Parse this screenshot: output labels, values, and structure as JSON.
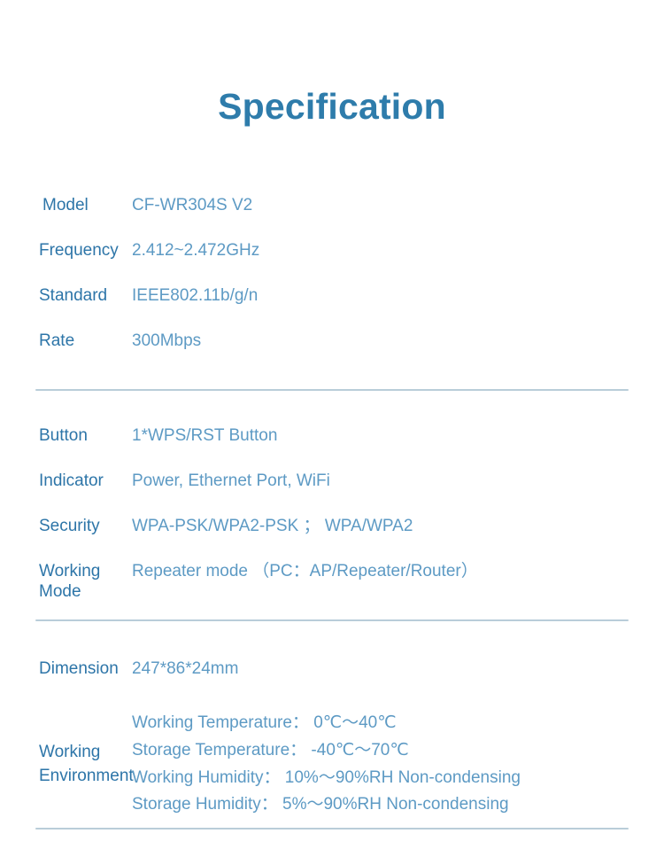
{
  "document": {
    "title": "Specification",
    "accent_color": "#2e7cab",
    "label_color": "#2d75a8",
    "value_color": "#5d9ac4",
    "divider_color": "#b9cdd9",
    "background_color": "#ffffff"
  },
  "sections": {
    "basic": {
      "rows": [
        {
          "label": "Model",
          "value": "CF-WR304S V2"
        },
        {
          "label": "Frequency",
          "value": "2.412~2.472GHz"
        },
        {
          "label": "Standard",
          "value": "IEEE802.11b/g/n"
        },
        {
          "label": "Rate",
          "value": "300Mbps"
        }
      ]
    },
    "features": {
      "rows": [
        {
          "label": "Button",
          "value": "1*WPS/RST Button"
        },
        {
          "label": "Indicator",
          "value": "Power, Ethernet Port, WiFi"
        },
        {
          "label": "Security",
          "value": "WPA-PSK/WPA2-PSK ；  WPA/WPA2"
        },
        {
          "label": "Working Mode",
          "value": "Repeater mode （PC：AP/Repeater/Router）"
        }
      ]
    },
    "physical": {
      "dimension": {
        "label": "Dimension",
        "value": "247*86*24mm"
      },
      "environment": {
        "label": "Working\nEnvironment",
        "lines": [
          "Working Temperature： 0℃～40℃",
          "Storage Temperature： -40℃～70℃",
          "Working Humidity： 10%～90%RH Non-condensing",
          "Storage Humidity： 5%～90%RH Non-condensing"
        ]
      }
    }
  }
}
